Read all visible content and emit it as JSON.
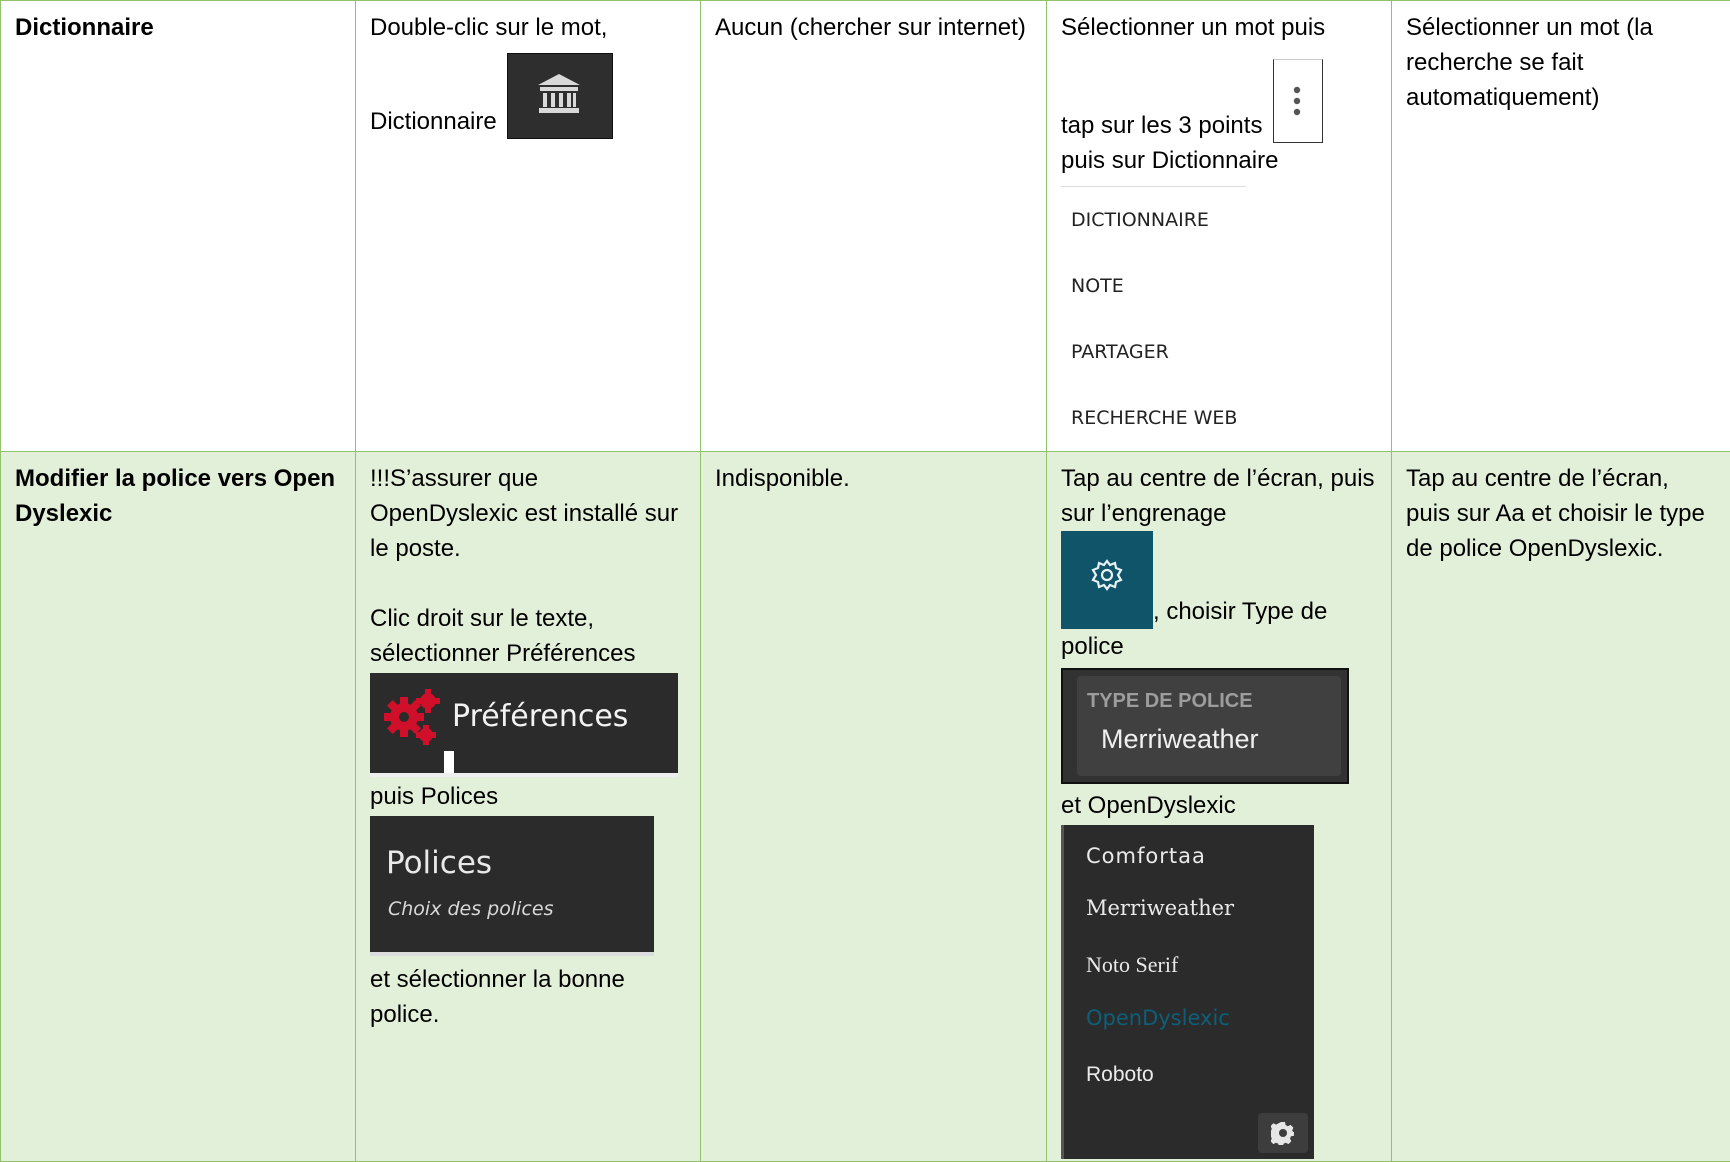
{
  "row1": {
    "header": "Dictionnaire",
    "col2": {
      "line1": "Double-clic sur le mot,",
      "line2": "Dictionnaire",
      "icon": "bank-icon"
    },
    "col3": "Aucun (chercher sur internet)",
    "col4": {
      "line1": "Sélectionner un mot puis",
      "line2": "tap sur les 3 points",
      "line3": "puis sur Dictionnaire",
      "menu": [
        "DICTIONNAIRE",
        "NOTE",
        "PARTAGER",
        "RECHERCHE WEB"
      ]
    },
    "col5": "Sélectionner un mot (la recherche se fait automatiquement)"
  },
  "row2": {
    "header": "Modifier la police vers Open Dyslexic",
    "col2": {
      "p1": "!!!S’assurer que OpenDyslexic est installé sur le poste.",
      "p2": "Clic droit sur le texte, sélectionner Préférences",
      "pref_label": "Préférences",
      "p3": "puis Polices",
      "polices_title": "Polices",
      "polices_sub": "Choix des polices",
      "p4": "et sélectionner la bonne police."
    },
    "col3": "Indisponible.",
    "col4": {
      "p1": "Tap au centre de l’écran, puis sur l’engrenage",
      "p2": ", choisir Type de police",
      "type_label": "TYPE DE POLICE",
      "type_value": "Merriweather",
      "p3": "et OpenDyslexic",
      "fonts": [
        "Comfortaa",
        "Merriweather",
        "Noto Serif",
        "OpenDyslexic",
        "Roboto"
      ]
    },
    "col5": "Tap au centre de l’écran, puis sur Aa et choisir le type de police OpenDyslexic."
  },
  "colors": {
    "border": "#8fc26b",
    "row2_bg": "#e2efd9",
    "gear_tile": "#0f5468",
    "pref_gears": "#d0102a"
  }
}
